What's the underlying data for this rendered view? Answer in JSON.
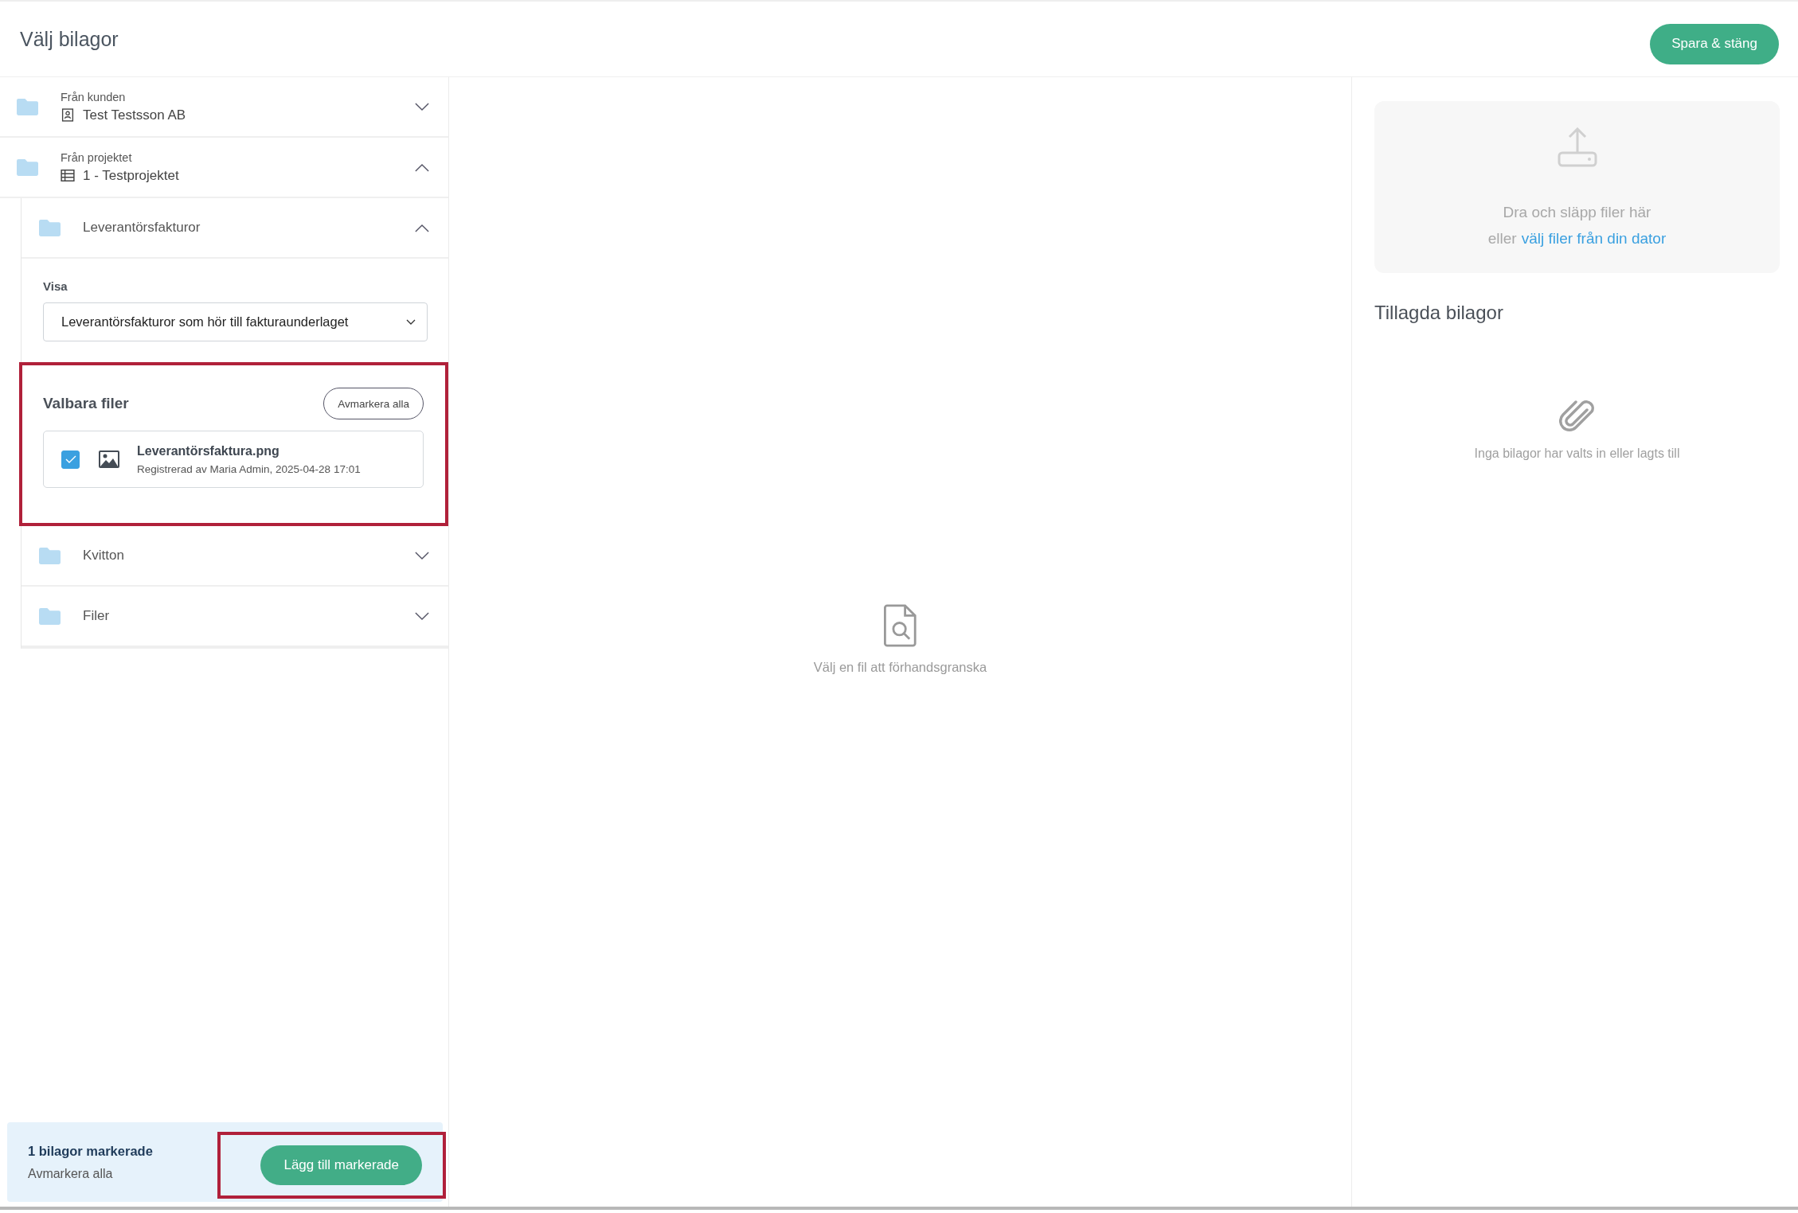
{
  "dialog": {
    "title": "Välj bilagor",
    "save_button": "Spara & stäng"
  },
  "sources": [
    {
      "label": "Från kunden",
      "value": "Test Testsson AB",
      "kind": "customer",
      "expanded": false
    },
    {
      "label": "Från projektet",
      "value": "1 - Testprojektet",
      "kind": "project",
      "expanded": true,
      "folders": [
        {
          "name": "Leverantörsfakturor",
          "expanded": true,
          "filter": {
            "label": "Visa",
            "value": "Leverantörsfakturor som hör till fakturaunderlaget"
          },
          "selectable": {
            "title": "Valbara filer",
            "highlighted": true,
            "clear_button": "Avmarkera alla",
            "files": [
              {
                "name": "Leverantörsfaktura.png",
                "meta": "Registrerad av Maria Admin, 2025-04-28 17:01",
                "checked": true
              }
            ]
          }
        },
        {
          "name": "Kvitton",
          "expanded": false
        },
        {
          "name": "Filer",
          "expanded": false
        }
      ]
    }
  ],
  "selection_bar": {
    "count": "1 bilagor markerade",
    "clear_link": "Avmarkera alla",
    "add_button": "Lägg till markerade",
    "highlighted": true
  },
  "preview": {
    "empty_text": "Välj en fil att förhandsgranska"
  },
  "upload": {
    "text": "Dra och släpp filer här",
    "prefix": "eller",
    "link": "välj filer från din dator"
  },
  "attached": {
    "title": "Tillagda bilagor",
    "empty_text": "Inga bilagor har valts in eller lagts till"
  }
}
